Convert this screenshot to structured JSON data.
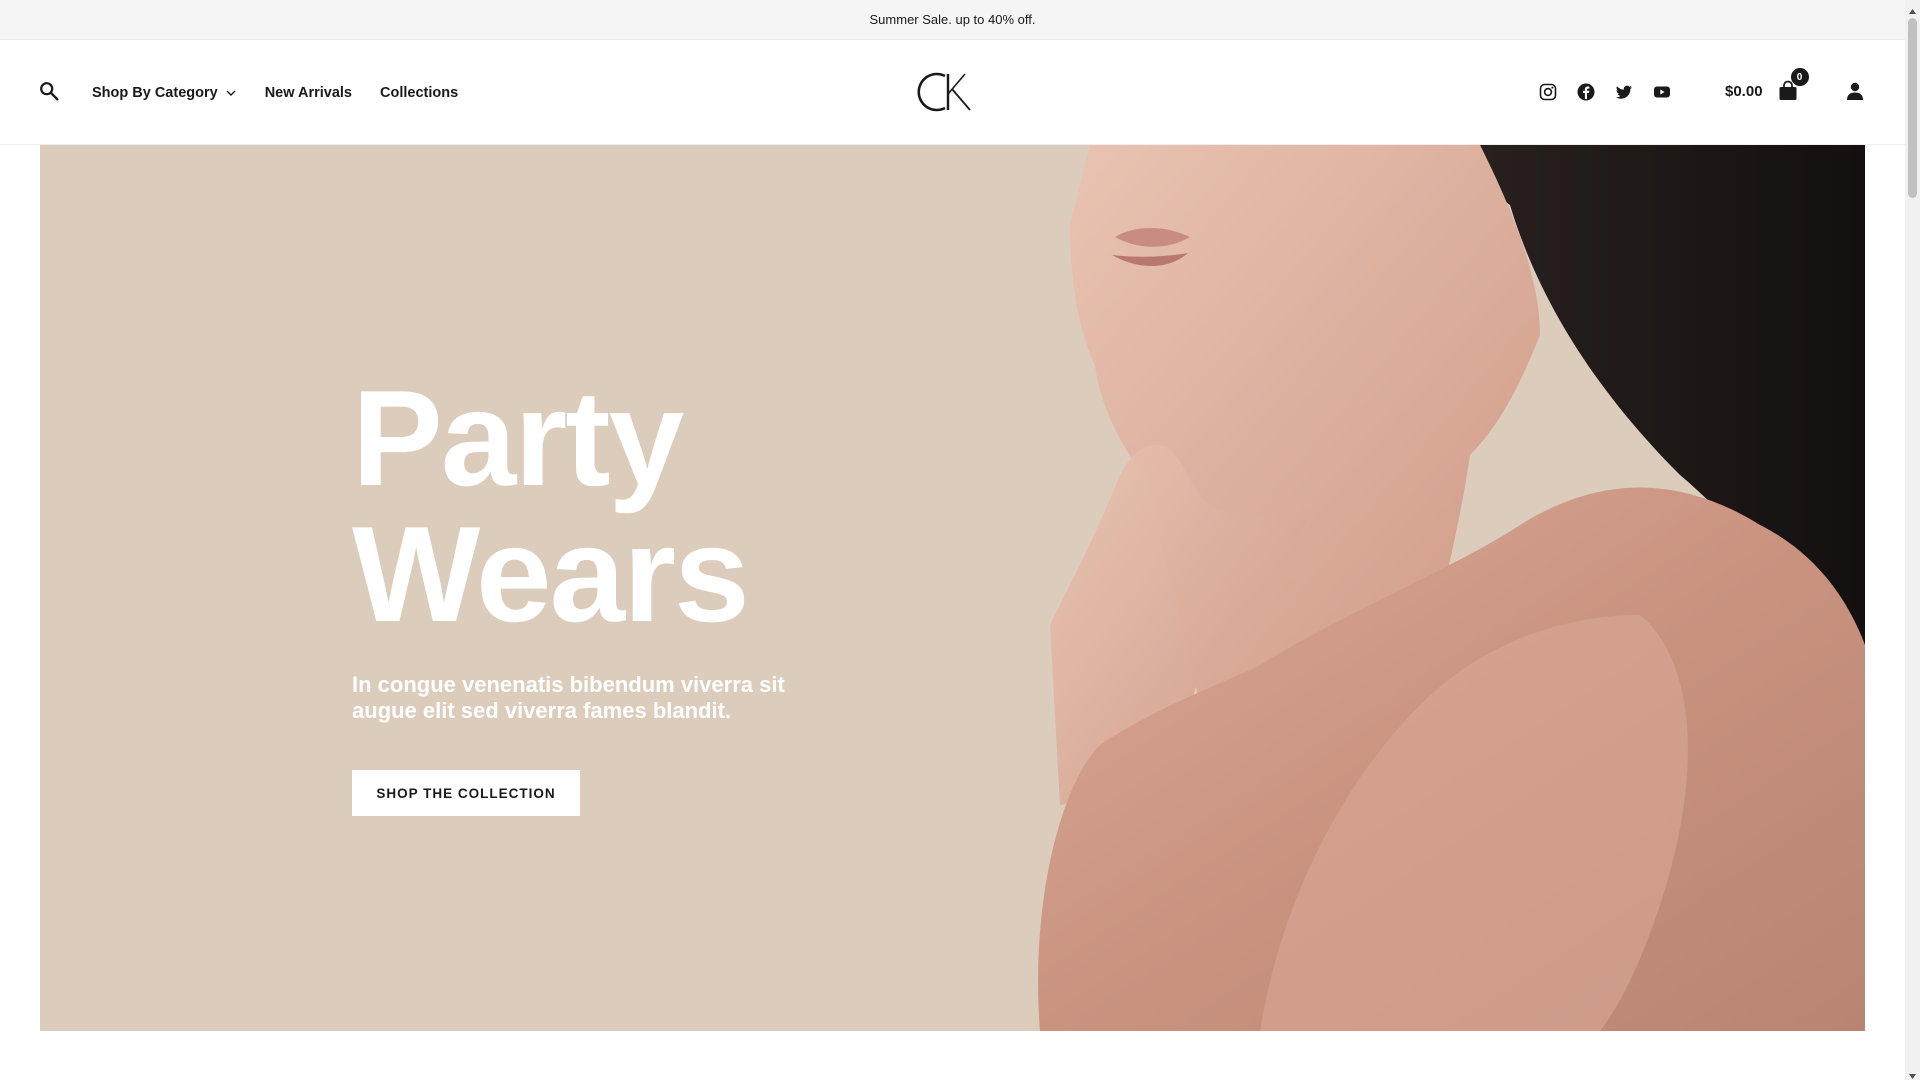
{
  "promo": {
    "text": "Summer Sale. up to 40% off."
  },
  "header": {
    "search_icon": "search-icon",
    "nav": [
      {
        "label": "Shop By Category",
        "has_dropdown": true
      },
      {
        "label": "New Arrivals"
      },
      {
        "label": "Collections"
      }
    ],
    "logo_text": "CK",
    "social_icons": [
      "instagram-icon",
      "facebook-icon",
      "twitter-icon",
      "youtube-icon"
    ],
    "cart": {
      "total": "$0.00",
      "count": "0",
      "icon": "shopping-bag-icon"
    },
    "account_icon": "user-icon"
  },
  "hero": {
    "title_line1": "Party",
    "title_line2": "Wears",
    "subtitle": "In congue venenatis bibendum viverra sit augue elit sed viverra fames blandit.",
    "cta_label": "SHOP THE COLLECTION",
    "background_color": "#dcccbc",
    "image": "model-in-pink-blouse"
  },
  "colors": {
    "accent": "#1a1a1a",
    "hero_bg": "#dcccbc",
    "promo_bg": "#f5f5f5"
  }
}
